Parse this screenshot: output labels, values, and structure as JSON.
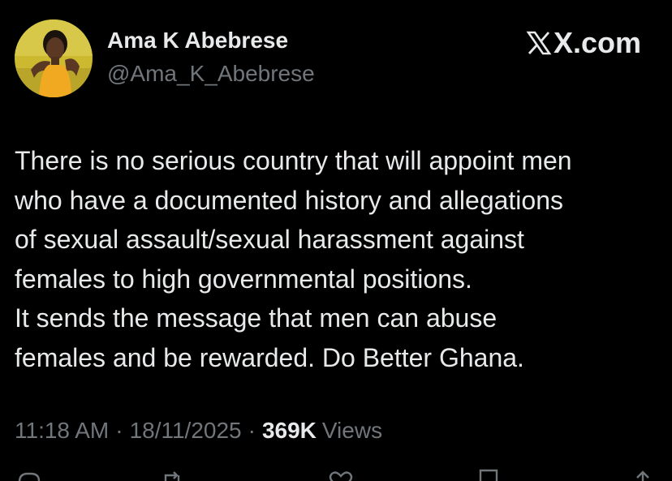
{
  "author": {
    "name": "Ama K Abebrese",
    "handle": "@Ama_K_Abebrese"
  },
  "brand": {
    "text": "X.com"
  },
  "tweet": {
    "lines": [
      "There is no serious country that will appoint men",
      "who have a documented history and allegations",
      "of sexual assault/sexual harassment against",
      "females to high governmental positions.",
      "It sends the message that men can abuse",
      "females and be rewarded. Do Better Ghana."
    ]
  },
  "meta": {
    "time": "11:18 AM",
    "separator": "·",
    "date": "18/11/2025",
    "views_count": "369K",
    "views_label": "Views"
  },
  "actions": [
    {
      "icon": "reply-icon"
    },
    {
      "icon": "retweet-icon"
    },
    {
      "icon": "like-icon"
    },
    {
      "icon": "bookmark-icon"
    },
    {
      "icon": "share-icon"
    }
  ],
  "colors": {
    "background": "#000000",
    "primary_text": "#e7e9ea",
    "secondary_text": "#71767b",
    "avatar_background": "#d9c238",
    "avatar_outfit": "#f2a922"
  }
}
